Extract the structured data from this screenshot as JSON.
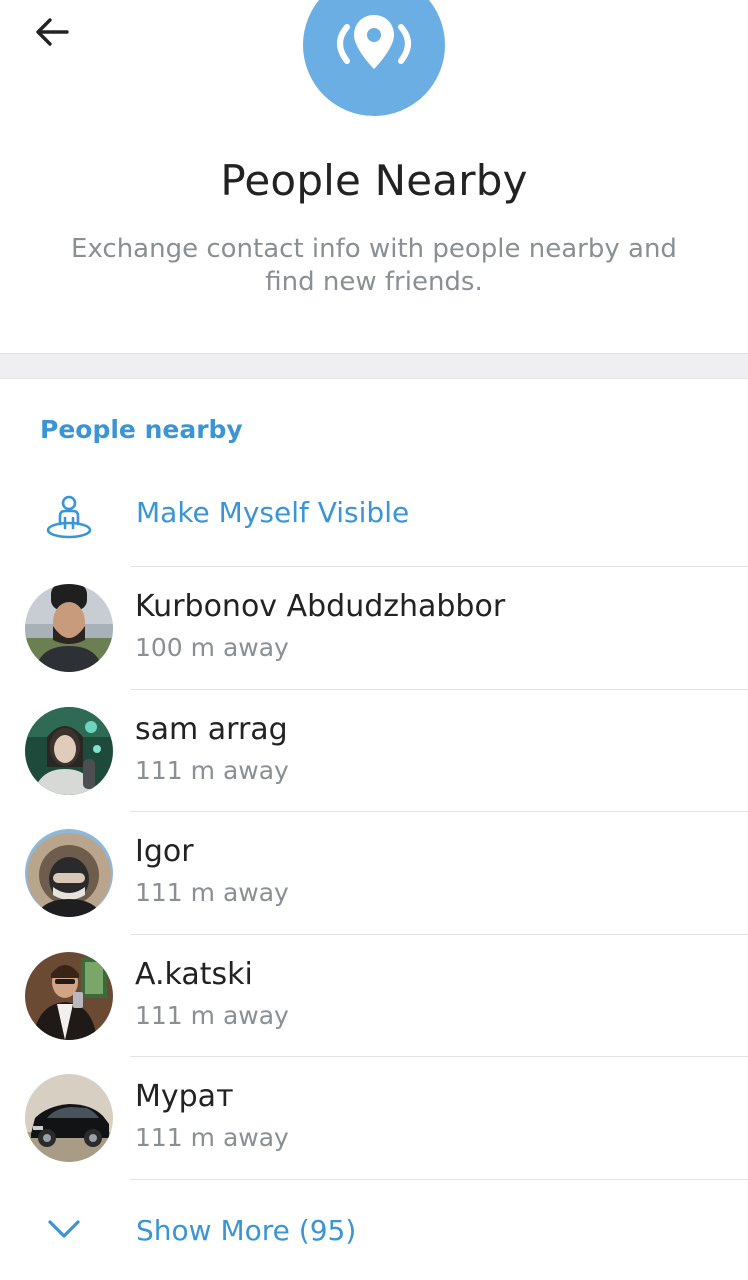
{
  "header": {
    "back_icon": "arrow-left-icon",
    "hero_icon": "location-pin-broadcast-icon",
    "title": "People Nearby",
    "subtitle": "Exchange contact info with people nearby and find new friends."
  },
  "section": {
    "header": "People nearby",
    "make_visible": {
      "icon": "person-on-pin-icon",
      "label": "Make Myself Visible"
    }
  },
  "people": [
    {
      "name": "Kurbonov Abdudzhabbor",
      "distance": "100 m away",
      "avatar": "avatar-photo"
    },
    {
      "name": "sam arrag",
      "distance": "111 m away",
      "avatar": "avatar-photo"
    },
    {
      "name": "Igor",
      "distance": "111 m away",
      "avatar": "avatar-photo"
    },
    {
      "name": "A.katski",
      "distance": "111 m away",
      "avatar": "avatar-photo"
    },
    {
      "name": "Мурат",
      "distance": "111 m away",
      "avatar": "avatar-photo"
    }
  ],
  "show_more": {
    "icon": "chevron-down-icon",
    "label": "Show More (95)"
  },
  "colors": {
    "accent": "#3a95d6",
    "hero_circle": "#6aaee3",
    "primary_text": "#222222",
    "secondary_text": "#8a8f94",
    "section_band": "#efeff1"
  }
}
